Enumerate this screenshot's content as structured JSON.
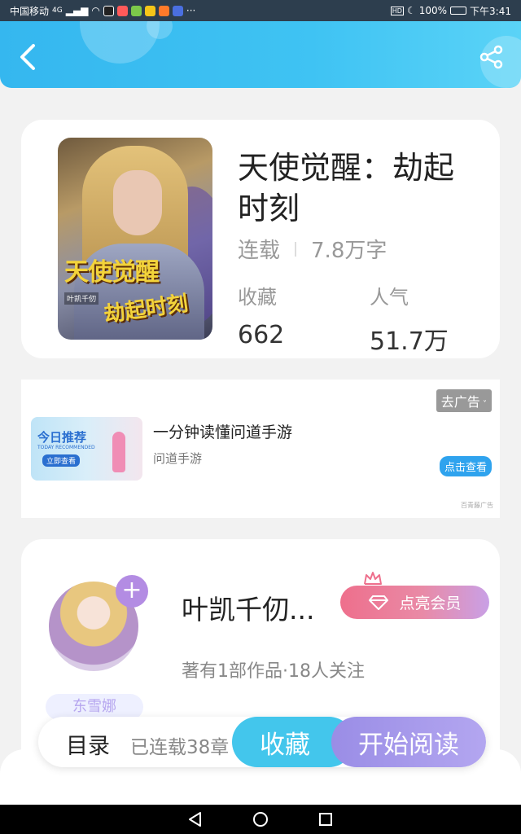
{
  "status_bar": {
    "carrier": "中国移动",
    "network": "4G",
    "more": "···",
    "battery": "100%",
    "time": "下午3:41"
  },
  "book": {
    "title": "天使觉醒：劫起时刻",
    "status": "连载",
    "word_count": "7.8万字",
    "collect_label": "收藏",
    "collect_value": "662",
    "popularity_label": "人气",
    "popularity_value": "51.7万",
    "cover_title_1": "天使觉醒",
    "cover_title_2": "劫起时刻",
    "cover_author": "叶凯千仞"
  },
  "ad": {
    "close_label": "去广告",
    "image_title": "今日推荐",
    "image_subtitle": "TODAY RECOMMENDED",
    "image_button": "立即查看",
    "title": "一分钟读懂问道手游",
    "subtitle": "问道手游",
    "action_label": "点击查看",
    "source": "百青藤广告"
  },
  "author": {
    "name": "叶凯千仞...",
    "follow_symbol": "+",
    "vip_label": "点亮会员",
    "meta": "著有1部作品·18人关注",
    "fan_badge": "东雪娜"
  },
  "bottom": {
    "toc_label": "目录",
    "toc_count": "已连载38章",
    "collect_label": "收藏",
    "read_label": "开始阅读"
  }
}
